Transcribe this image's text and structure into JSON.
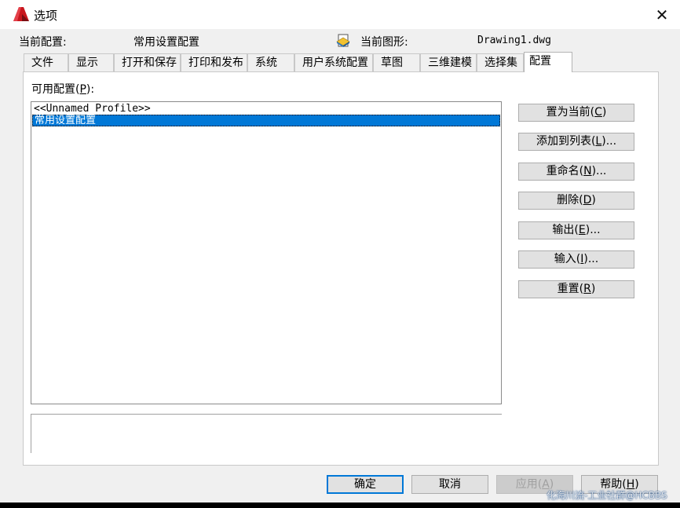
{
  "window": {
    "title": "选项",
    "close_glyph": "✕"
  },
  "header": {
    "current_config_label": "当前配置:",
    "current_config_value": "常用设置配置",
    "current_drawing_label": "当前图形:",
    "current_drawing_value": "Drawing1.dwg"
  },
  "tabs": [
    {
      "label": "文件"
    },
    {
      "label": "显示"
    },
    {
      "label": "打开和保存"
    },
    {
      "label": "打印和发布"
    },
    {
      "label": "系统"
    },
    {
      "label": "用户系统配置"
    },
    {
      "label": "草图"
    },
    {
      "label": "三维建模"
    },
    {
      "label": "选择集"
    },
    {
      "label": "配置"
    }
  ],
  "profiles": {
    "label_prefix": "可用配置(",
    "label_key": "P",
    "label_suffix": "):",
    "items": [
      "<<Unnamed Profile>>",
      "常用设置配置"
    ],
    "selected_index": 1
  },
  "side_buttons": {
    "set_current": {
      "pre": "置为当前(",
      "key": "C",
      "post": ")"
    },
    "add_to_list": {
      "pre": "添加到列表(",
      "key": "L",
      "post": ")..."
    },
    "rename": {
      "pre": "重命名(",
      "key": "N",
      "post": ")..."
    },
    "delete": {
      "pre": "删除(",
      "key": "D",
      "post": ")"
    },
    "export": {
      "pre": "输出(",
      "key": "E",
      "post": ")..."
    },
    "import": {
      "pre": "输入(",
      "key": "I",
      "post": ")..."
    },
    "reset": {
      "pre": "重置(",
      "key": "R",
      "post": ")"
    }
  },
  "bottom_buttons": {
    "ok": "确定",
    "cancel": "取消",
    "apply": {
      "pre": "应用(",
      "key": "A",
      "post": ")"
    },
    "help": {
      "pre": "帮助(",
      "key": "H",
      "post": ")"
    }
  },
  "watermark": "化海川流-工业社群@HCBBS",
  "colors": {
    "selection": "#0078d7",
    "app_icon": "#c8161d"
  }
}
